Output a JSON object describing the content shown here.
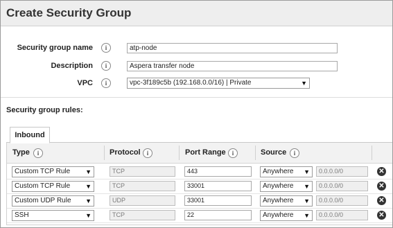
{
  "title": "Create Security Group",
  "form": {
    "name_label": "Security group name",
    "name_value": "atp-node",
    "desc_label": "Description",
    "desc_value": "Aspera transfer node",
    "vpc_label": "VPC",
    "vpc_value": "vpc-3f189c5b (192.168.0.0/16) | Private",
    "info_glyph": "i"
  },
  "rules_label": "Security group rules:",
  "tab": "Inbound",
  "columns": {
    "type": "Type",
    "protocol": "Protocol",
    "port_range": "Port Range",
    "source": "Source"
  },
  "rules": [
    {
      "type": "Custom TCP Rule",
      "protocol": "TCP",
      "port": "443",
      "source": "Anywhere",
      "cidr": "0.0.0.0/0"
    },
    {
      "type": "Custom TCP Rule",
      "protocol": "TCP",
      "port": "33001",
      "source": "Anywhere",
      "cidr": "0.0.0.0/0"
    },
    {
      "type": "Custom UDP Rule",
      "protocol": "UDP",
      "port": "33001",
      "source": "Anywhere",
      "cidr": "0.0.0.0/0"
    },
    {
      "type": "SSH",
      "protocol": "TCP",
      "port": "22",
      "source": "Anywhere",
      "cidr": "0.0.0.0/0"
    }
  ],
  "icons": {
    "info": "info-icon",
    "dropdown": "chevron-down-icon",
    "delete": "delete-rule-icon"
  }
}
